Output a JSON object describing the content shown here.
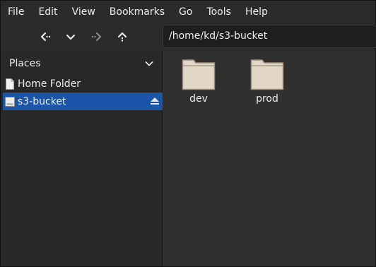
{
  "menubar": {
    "items": [
      "File",
      "Edit",
      "View",
      "Bookmarks",
      "Go",
      "Tools",
      "Help"
    ]
  },
  "toolbar": {
    "buttons": [
      {
        "name": "back",
        "icon": "back-arrow-icon",
        "enabled": true
      },
      {
        "name": "history",
        "icon": "chevron-down-icon",
        "enabled": true
      },
      {
        "name": "forward",
        "icon": "forward-arrow-icon",
        "enabled": false
      },
      {
        "name": "up",
        "icon": "up-arrow-icon",
        "enabled": true
      }
    ],
    "path": "/home/kd/s3-bucket"
  },
  "sidebar": {
    "header": "Places",
    "items": [
      {
        "label": "Home Folder",
        "icon": "document-icon",
        "selected": false
      },
      {
        "label": "s3-bucket",
        "icon": "drive-icon",
        "selected": true,
        "eject": true
      }
    ]
  },
  "main": {
    "files": [
      {
        "name": "dev",
        "icon": "folder-icon"
      },
      {
        "name": "prod",
        "icon": "folder-icon"
      }
    ]
  },
  "colors": {
    "selection": "#1b55a7",
    "folder": "#e2d6c6",
    "background": "#303030"
  }
}
